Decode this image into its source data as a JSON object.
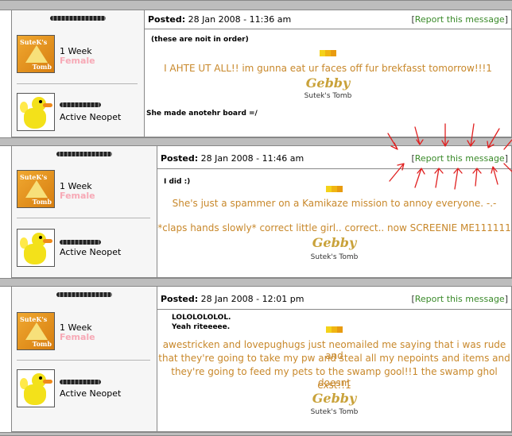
{
  "posts": [
    {
      "week": "1 Week",
      "gender": "Female",
      "status": "Active Neopet",
      "posted_label": "Posted:",
      "date": "28 Jan 2008 - 11:36 am",
      "report": "Report this message",
      "small_top": "(these are noit in order)",
      "message_lines": [
        "I AHTE UT ALL!! im gunna eat ur faces off fur brekfasst tomorrow!!!1"
      ],
      "sig_name": "Gebby",
      "sig_sub": "Sutek's Tomb",
      "reply": "She made anotehr board =/"
    },
    {
      "week": "1 Week",
      "gender": "Female",
      "status": "Active Neopet",
      "posted_label": "Posted:",
      "date": "28 Jan 2008 - 11:46 am",
      "report": "Report this message",
      "small_top": "I did :)",
      "message_lines": [
        "She's just a spammer on a Kamikaze mission to annoy everyone. -.-",
        "*claps hands slowly* correct little girl.. correct.. now SCREENIE ME111111"
      ],
      "sig_name": "Gebby",
      "sig_sub": "Sutek's Tomb"
    },
    {
      "week": "1 Week",
      "gender": "Female",
      "status": "Active Neopet",
      "posted_label": "Posted:",
      "date": "28 Jan 2008 - 12:01 pm",
      "report": "Report this message",
      "small_top": "LOLOLOLOLOL.",
      "small_top2": "Yeah riteeeee.",
      "message_lines": [
        "awestricken and lovepughugs just neomailed me saying that i was rude and",
        "that they're going to take my pw and steal all my nepoints and items and",
        "they're going to feed my pets to the swamp gool!!1 the swamp ghol doesnt",
        "exst!!1"
      ],
      "sig_name": "Gebby",
      "sig_sub": "Sutek's Tomb"
    }
  ],
  "shield": {
    "sig": "SuteK's",
    "tomb": "Tomb"
  },
  "colors": {
    "accent": "#c8882b",
    "report_link": "#3a8a2a",
    "female": "#f7a9b6",
    "annotation": "#e02020"
  }
}
